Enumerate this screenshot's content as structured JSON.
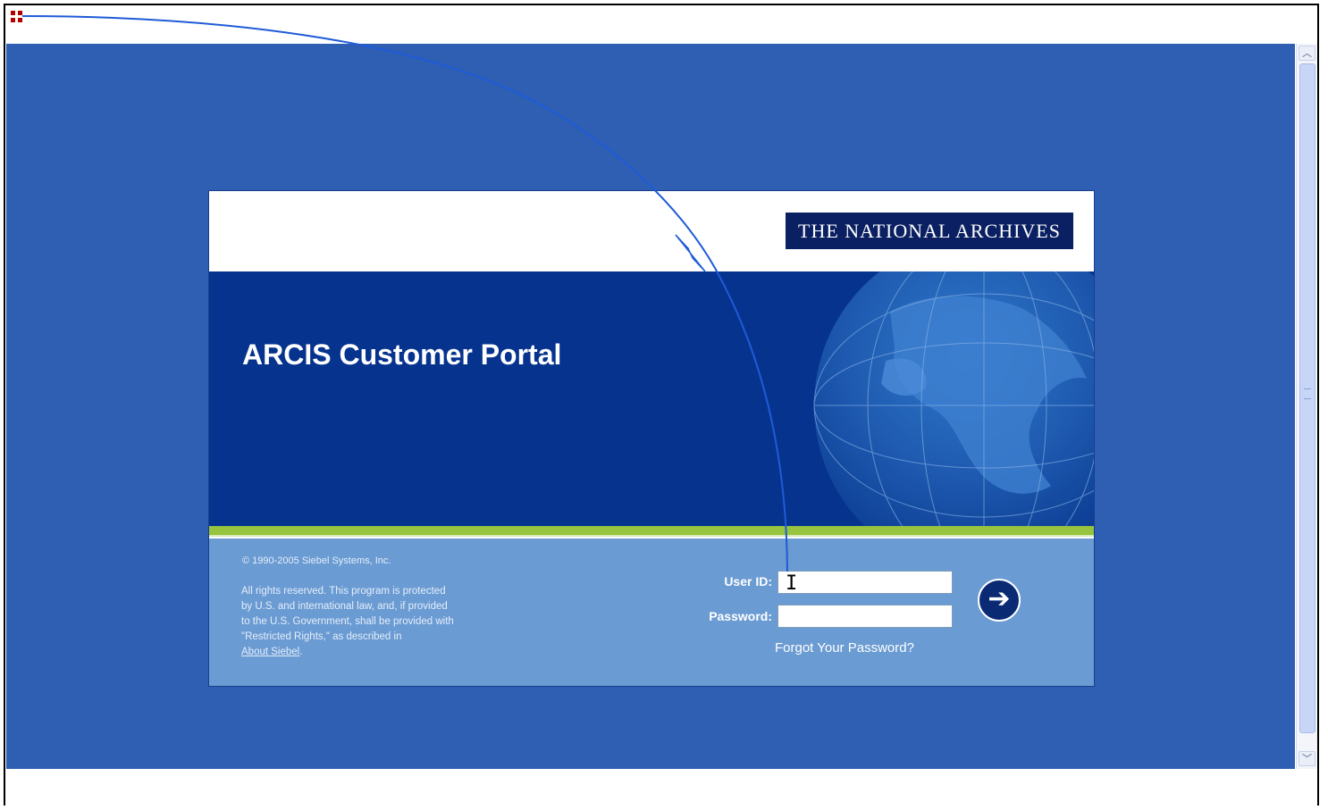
{
  "app": {
    "logo_text": "THE NATIONAL ARCHIVES",
    "portal_title": "ARCIS Customer Portal"
  },
  "legal": {
    "copyright": "© 1990-2005 Siebel Systems, Inc.",
    "lines": [
      "All rights reserved. This program is protected",
      "by U.S. and international law, and, if provided",
      "to the U.S. Government, shall be provided with",
      "\"Restricted Rights,\" as described in"
    ],
    "about_link": "About Siebel",
    "about_suffix": "."
  },
  "login": {
    "user_id_label": "User ID:",
    "password_label": "Password:",
    "user_id_value": "",
    "password_value": "",
    "forgot_password": "Forgot Your Password?",
    "submit_icon": "right-arrow-icon"
  },
  "scrollbar": {
    "up_icon": "chevron-up-icon",
    "down_icon": "chevron-down-icon"
  },
  "colors": {
    "page_background": "#2f5fb3",
    "header_blue": "#06338e",
    "accent_green": "#96c43e",
    "login_panel": "#6a9bd2",
    "logo_navy": "#0a2062"
  }
}
